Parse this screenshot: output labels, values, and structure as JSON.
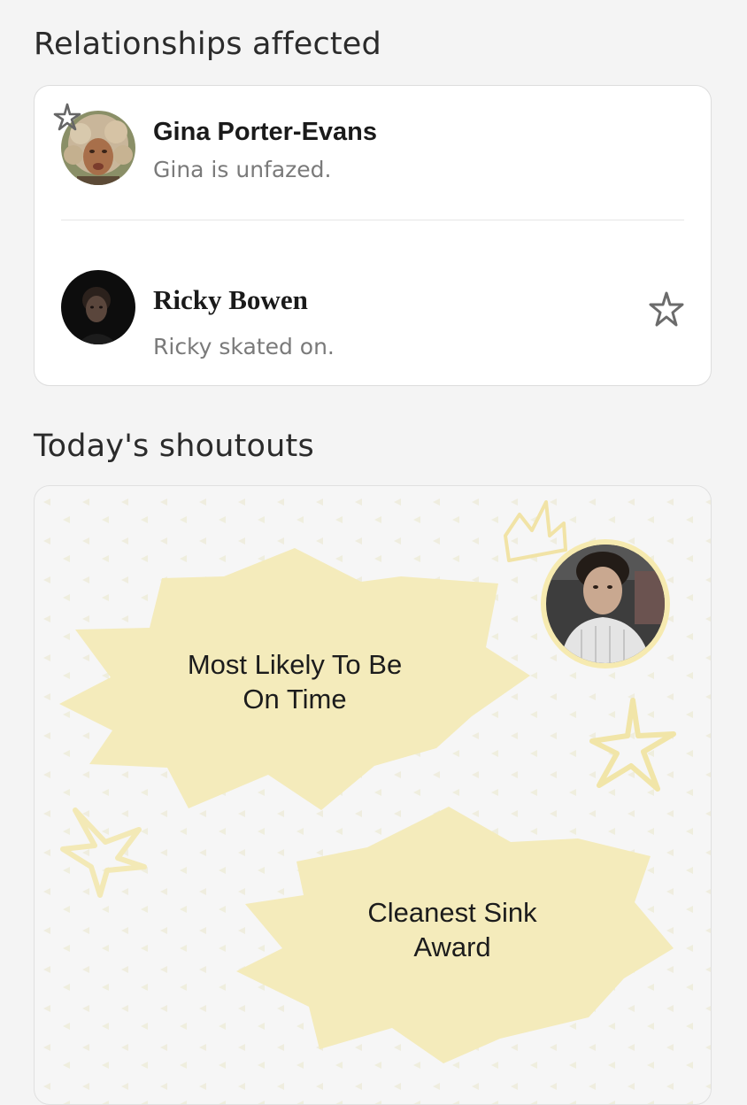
{
  "relationships": {
    "title": "Relationships affected",
    "items": [
      {
        "name": "Gina Porter-Evans",
        "status": "Gina is unfazed.",
        "avatar": "gina-avatar"
      },
      {
        "name": "Ricky Bowen",
        "status": "Ricky skated on.",
        "avatar": "ricky-avatar"
      }
    ]
  },
  "shoutouts": {
    "title": "Today's shoutouts",
    "awards": [
      {
        "line1": "Most Likely To Be",
        "line2": "On Time"
      },
      {
        "line1": "Cleanest Sink",
        "line2": "Award"
      }
    ]
  },
  "colors": {
    "burst": "#f4ebbb",
    "doodle": "#f1e5a8",
    "card": "#ffffff",
    "muted_text": "#7a7a7a"
  },
  "icons": [
    "star-doodle-icon",
    "crown-doodle-icon"
  ]
}
